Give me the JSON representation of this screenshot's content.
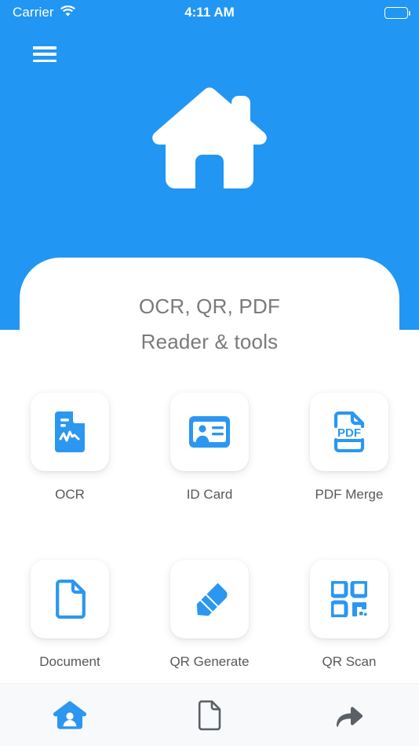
{
  "status_bar": {
    "carrier": "Carrier",
    "time": "4:11 AM",
    "wifi_icon": "wifi-icon",
    "battery_icon": "battery-full-icon"
  },
  "header": {
    "menu_icon": "hamburger-menu-icon",
    "logo_icon": "house-logo-icon"
  },
  "main": {
    "title_line1": "OCR, QR, PDF",
    "title_line2": "Reader & tools",
    "tools": [
      {
        "label": "OCR",
        "icon": "ocr-document-icon"
      },
      {
        "label": "ID Card",
        "icon": "id-card-icon"
      },
      {
        "label": "PDF Merge",
        "icon": "pdf-file-icon"
      },
      {
        "label": "Document",
        "icon": "document-page-icon"
      },
      {
        "label": "QR Generate",
        "icon": "pen-icon"
      },
      {
        "label": "QR Scan",
        "icon": "qr-code-icon"
      }
    ]
  },
  "tabbar": {
    "tabs": [
      {
        "name": "home",
        "icon": "home-person-icon",
        "active": true
      },
      {
        "name": "files",
        "icon": "document-outline-icon",
        "active": false
      },
      {
        "name": "share",
        "icon": "share-arrow-icon",
        "active": false
      }
    ]
  },
  "colors": {
    "brand_blue": "#2196f3",
    "icon_blue": "#2b97f0",
    "title_gray": "#7a7a7a",
    "label_gray": "#585858",
    "tabbar_bg": "#f8f9fa",
    "tab_inactive": "#5a6066"
  }
}
